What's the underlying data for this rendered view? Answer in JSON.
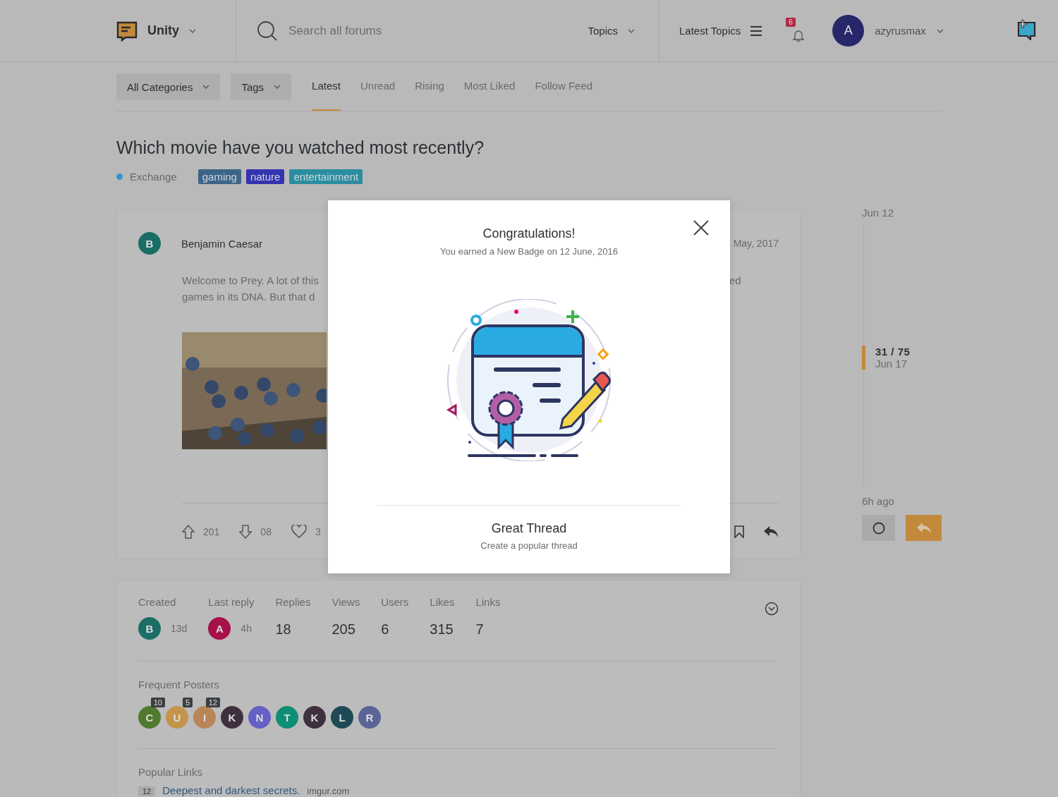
{
  "header": {
    "brand": "Unity",
    "search": {
      "placeholder": "Search all forums"
    },
    "topics_menu": "Topics",
    "latest_topics": "Latest Topics",
    "notifications": "6",
    "user": {
      "initial": "A",
      "name": "azyrusmax"
    }
  },
  "filters": [
    {
      "label": "All Categories"
    },
    {
      "label": "Tags"
    }
  ],
  "tabs": [
    {
      "label": "Latest",
      "selected": true
    },
    {
      "label": "Unread",
      "selected": false
    },
    {
      "label": "Rising",
      "selected": false
    },
    {
      "label": "Most Liked",
      "selected": false
    },
    {
      "label": "Follow Feed",
      "selected": false
    }
  ],
  "topic": {
    "title": "Which movie have you watched most recently?",
    "category": {
      "name": "Exchange",
      "color": "#2f95d0"
    },
    "tags": [
      {
        "label": "gaming",
        "color": "#3c6487"
      },
      {
        "label": "nature",
        "color": "#3434b0"
      },
      {
        "label": "entertainment",
        "color": "#2a8ea0"
      }
    ]
  },
  "post": {
    "author": {
      "initial": "B",
      "name": "Benjamin Caesar",
      "color": "#1b6e66"
    },
    "date": "May, 2017",
    "body_left": [
      "Welcome to Prey. A lot of this",
      "games in its DNA. But that d"
    ],
    "body_right": [
      "ed"
    ],
    "upvotes": "201",
    "downvotes": "08",
    "likes": "3"
  },
  "timeline": {
    "start": "Jun 12",
    "position": "31 / 75",
    "position_date": "Jun 17",
    "end": "6h ago"
  },
  "stats": {
    "created": {
      "label": "Created",
      "initial": "B",
      "color": "#1b6e66",
      "age": "13d"
    },
    "last_reply": {
      "label": "Last reply",
      "initial": "A",
      "color": "#a8104a",
      "age": "4h"
    },
    "counts": [
      {
        "label": "Replies",
        "value": "18"
      },
      {
        "label": "Views",
        "value": "205"
      },
      {
        "label": "Users",
        "value": "6"
      },
      {
        "label": "Likes",
        "value": "315"
      },
      {
        "label": "Links",
        "value": "7"
      }
    ],
    "frequent_posters_title": "Frequent Posters",
    "frequent_posters": [
      {
        "initial": "C",
        "color": "#4f7a2e",
        "count": "10"
      },
      {
        "initial": "U",
        "color": "#c4944a",
        "count": "5"
      },
      {
        "initial": "I",
        "color": "#b98658",
        "count": "12"
      },
      {
        "initial": "K",
        "color": "#3f3040"
      },
      {
        "initial": "N",
        "color": "#6560c4"
      },
      {
        "initial": "T",
        "color": "#0e8f75"
      },
      {
        "initial": "K",
        "color": "#3f3040"
      },
      {
        "initial": "L",
        "color": "#1e4a55"
      },
      {
        "initial": "R",
        "color": "#5a6496"
      }
    ],
    "popular_links_title": "Popular Links",
    "popular_links": [
      {
        "count": "12",
        "title": "Deepest and darkest secrets.",
        "domain": "imgur.com"
      }
    ]
  },
  "modal": {
    "title": "Congratulations!",
    "subtitle": "You earned a New Badge on 12 June, 2016",
    "badge_name": "Great Thread",
    "badge_description": "Create a popular thread"
  }
}
